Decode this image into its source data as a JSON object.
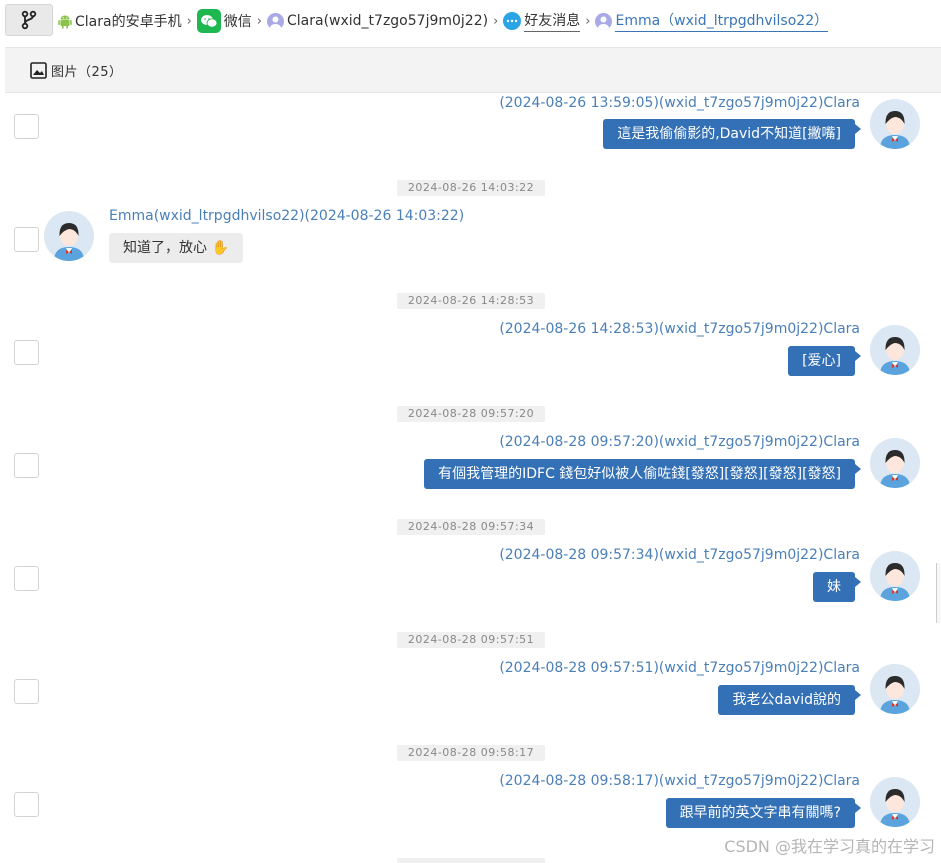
{
  "breadcrumb": {
    "items": [
      {
        "label": "Clara的安卓手机",
        "icon": "android-icon"
      },
      {
        "label": "微信",
        "icon": "wechat-icon"
      },
      {
        "label": "Clara(wxid_t7zgo57j9m0j22)",
        "icon": "person-icon"
      },
      {
        "label": "好友消息",
        "icon": "chat-bubble-icon"
      },
      {
        "label": "Emma（wxid_ltrpgdhvilso22）",
        "icon": "person-icon"
      }
    ]
  },
  "tabs": {
    "images_label": "图片（25）"
  },
  "messages": [
    {
      "id": "m1",
      "side": "right",
      "timestamp": "",
      "header": "(2024-08-26 13:59:05)(wxid_t7zgo57j9m0j22)Clara",
      "text": "這是我偷偷影的,David不知道[撇嘴]"
    },
    {
      "id": "m2",
      "side": "left",
      "timestamp": "2024-08-26 14:03:22",
      "header": "Emma(wxid_ltrpgdhvilso22)(2024-08-26 14:03:22)",
      "text": "知道了，放心 ✋"
    },
    {
      "id": "m3",
      "side": "right",
      "timestamp": "2024-08-26 14:28:53",
      "header": "(2024-08-26 14:28:53)(wxid_t7zgo57j9m0j22)Clara",
      "text": "[爱心]"
    },
    {
      "id": "m4",
      "side": "right",
      "timestamp": "2024-08-28 09:57:20",
      "header": "(2024-08-28 09:57:20)(wxid_t7zgo57j9m0j22)Clara",
      "text": "有個我管理的IDFC 錢包好似被人偷咗錢[發怒][發怒][發怒][發怒]"
    },
    {
      "id": "m5",
      "side": "right",
      "timestamp": "2024-08-28 09:57:34",
      "header": "(2024-08-28 09:57:34)(wxid_t7zgo57j9m0j22)Clara",
      "text": "妹"
    },
    {
      "id": "m6",
      "side": "right",
      "timestamp": "2024-08-28 09:57:51",
      "header": "(2024-08-28 09:57:51)(wxid_t7zgo57j9m0j22)Clara",
      "text": "我老公david說的"
    },
    {
      "id": "m7",
      "side": "right",
      "timestamp": "2024-08-28 09:58:17",
      "header": "(2024-08-28 09:58:17)(wxid_t7zgo57j9m0j22)Clara",
      "text": "跟早前的英文字串有關嗎?"
    }
  ],
  "watermark": "CSDN @我在学习真的在学习",
  "colors": {
    "accent": "#3470b5",
    "header_text": "#4a7fb8",
    "wechat_green": "#1fb74f"
  }
}
